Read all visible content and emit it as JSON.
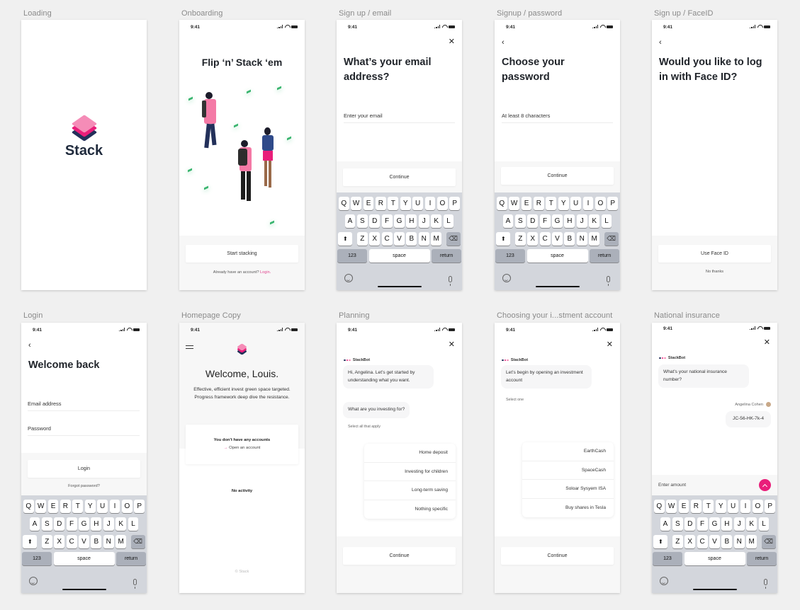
{
  "status_bar": {
    "time": "9:41"
  },
  "screens": {
    "loading": {
      "label": "Loading",
      "brand": "Stack"
    },
    "onboarding": {
      "label": "Onboarding",
      "title": "Flip ‘n’ Stack ‘em",
      "button": "Start stacking",
      "footer_text": "Already have an account?",
      "footer_link": "Login."
    },
    "signup_email": {
      "label": "Sign up / email",
      "title": "What’s your email address?",
      "input_placeholder": "Enter your email",
      "button": "Continue"
    },
    "signup_password": {
      "label": "Signup / password",
      "title": "Choose your password",
      "input_placeholder": "At least 8 characters",
      "button": "Continue"
    },
    "signup_faceid": {
      "label": "Sign up / FaceID",
      "title": "Would you like to log in with Face ID?",
      "button": "Use Face ID",
      "secondary_link": "No thanks"
    },
    "login": {
      "label": "Login",
      "title": "Welcome back",
      "email_placeholder": "Email address",
      "password_placeholder": "Password",
      "button": "Login",
      "forgot_link": "Forgot password?"
    },
    "homepage": {
      "label": "Homepage Copy",
      "title": "Welcome, Louis.",
      "body": "Effective, efficient invest green space targeted. Progress framework deep dive the resistance.",
      "card_title": "You don't have any accounts",
      "card_link": "Open an account",
      "empty_state": "No activity",
      "footer": "© Stack"
    },
    "planning": {
      "label": "Planning",
      "bot_name": "StackBot",
      "message_1": "Hi, Angelina. Let’s get started by understanding what you want.",
      "message_2": "What are you investing for?",
      "hint": "Select all that apply",
      "options": [
        "Home deposit",
        "Investing for children",
        "Long-term saving",
        "Nothing specific"
      ],
      "button": "Continue"
    },
    "choosing_account": {
      "label": "Choosing your i...stment account",
      "bot_name": "StackBot",
      "message_1": "Let’s begin by opening an investment account",
      "hint": "Select one",
      "options": [
        "EarthCash",
        "SpaceCash",
        "Soloar Sysyem ISA",
        "Buy shares in Tesla"
      ],
      "button": "Continue"
    },
    "national_insurance": {
      "label": "National insurance",
      "bot_name": "StackBot",
      "message_1": "What's your national insurance number?",
      "user_name": "Angelina Cohen",
      "user_reply": "JC-56-HK-7k-4",
      "input_placeholder": "Enter amount"
    }
  },
  "keyboard": {
    "row1": [
      "Q",
      "W",
      "E",
      "R",
      "T",
      "Y",
      "U",
      "I",
      "O",
      "P"
    ],
    "row2": [
      "A",
      "S",
      "D",
      "F",
      "G",
      "H",
      "J",
      "K",
      "L"
    ],
    "row3": [
      "Z",
      "X",
      "C",
      "V",
      "B",
      "N",
      "M"
    ],
    "numbers_key": "123",
    "space_key": "space",
    "return_key": "return"
  },
  "colors": {
    "brand_pink": "#e91e7a",
    "light_pink": "#f58cb7",
    "navy": "#23305a",
    "link_pink": "#e0458f",
    "background": "#f0f0f0",
    "keyboard_bg": "#d3d6dc"
  },
  "icons": {
    "close": "✕",
    "back": "‹",
    "arrow": "→",
    "shift": "⬆",
    "backspace": "⌫"
  }
}
